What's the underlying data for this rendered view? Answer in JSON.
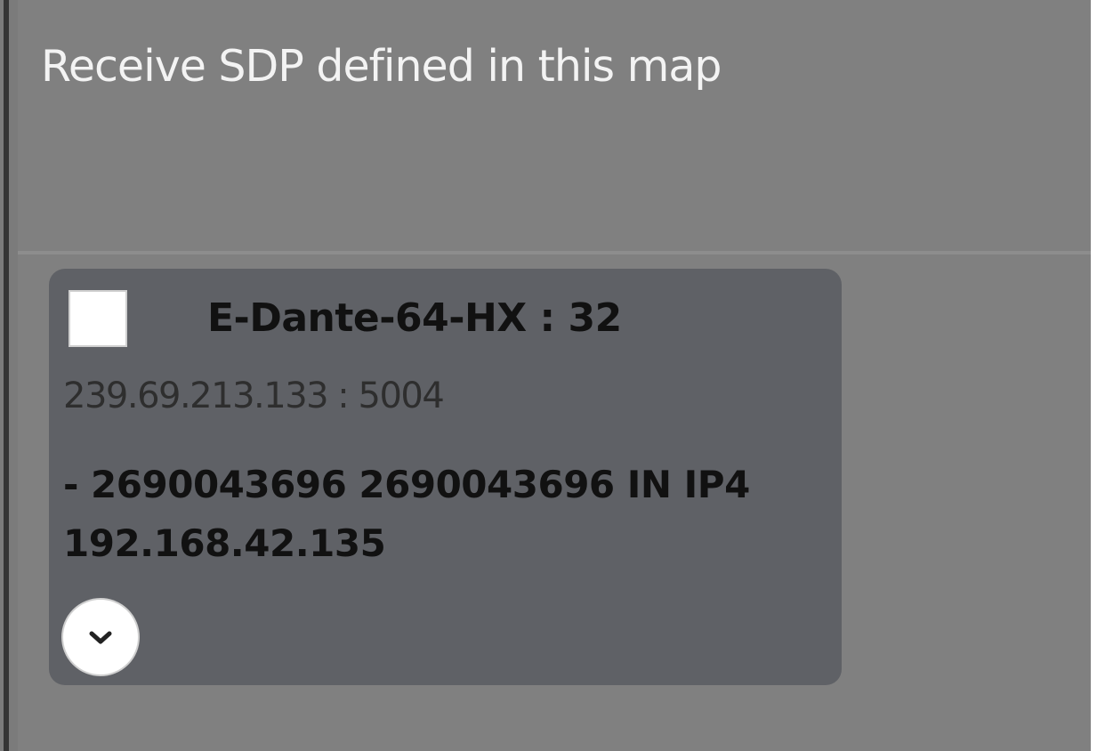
{
  "panel": {
    "title": "Receive SDP defined in this map"
  },
  "stream_card": {
    "name": "E-Dante-64-HX : 32",
    "address": "239.69.213.133 : 5004",
    "origin": "- 2690043696 2690043696 IN IP4 192.168.42.135",
    "checked": false,
    "expand_icon": "chevron-down-icon"
  },
  "colors": {
    "background": "#808080",
    "card": "#5f6166",
    "header_text": "#f3f3f3"
  }
}
